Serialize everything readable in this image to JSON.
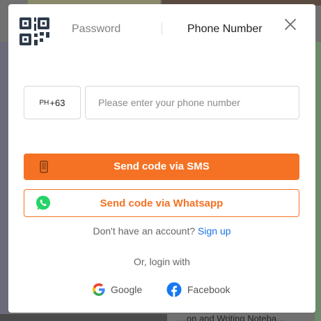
{
  "tabs": {
    "password": "Password",
    "phone_number": "Phone Number"
  },
  "phone": {
    "country_prefix": "PH",
    "country_code": "+63",
    "placeholder": "Please enter your phone number",
    "value": ""
  },
  "buttons": {
    "sms": "Send code via SMS",
    "whatsapp": "Send code via Whatsapp"
  },
  "signup": {
    "prompt": "Don't have an account?",
    "link": "Sign up"
  },
  "social": {
    "heading": "Or, login with",
    "google": "Google",
    "facebook": "Facebook"
  },
  "background": {
    "bottom_text": "…on and Writing Noteba…"
  },
  "colors": {
    "accent": "#f57224",
    "link": "#1a73e8",
    "whatsapp": "#25d366",
    "facebook": "#1877f2"
  },
  "icons": [
    "qr-code-icon",
    "close-icon",
    "mobile-phone-icon",
    "whatsapp-icon",
    "google-icon",
    "facebook-icon"
  ]
}
